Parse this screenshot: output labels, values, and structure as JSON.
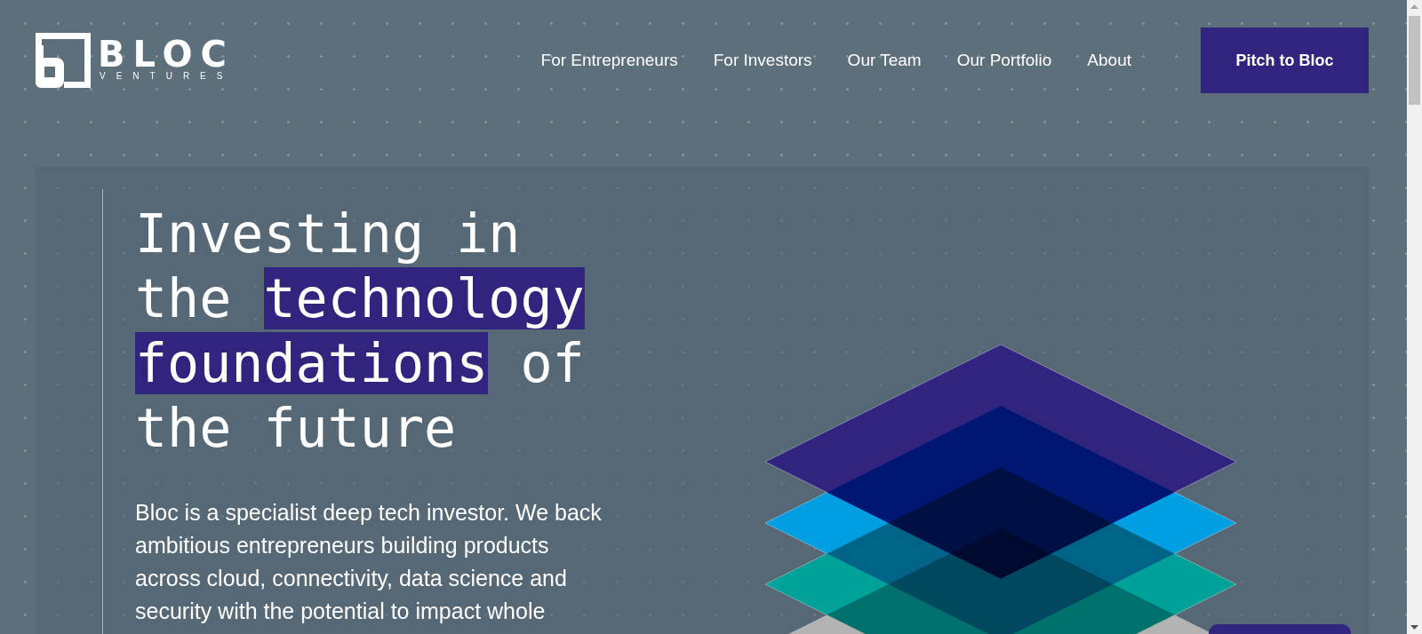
{
  "header": {
    "logo": {
      "name": "BLOC",
      "tagline": "VENTURES"
    },
    "nav": [
      "For Entrepreneurs",
      "For Investors",
      "Our Team",
      "Our Portfolio",
      "About"
    ],
    "cta": "Pitch to Bloc"
  },
  "hero": {
    "heading": [
      {
        "text": "Investing in the ",
        "highlight": false
      },
      {
        "text": "technology foundations",
        "highlight": true
      },
      {
        "text": " of the future",
        "highlight": false
      }
    ],
    "intro": "Bloc is a specialist deep tech investor. We back ambitious entrepreneurs building products across cloud, connectivity, data science and security with the potential to impact whole"
  }
}
